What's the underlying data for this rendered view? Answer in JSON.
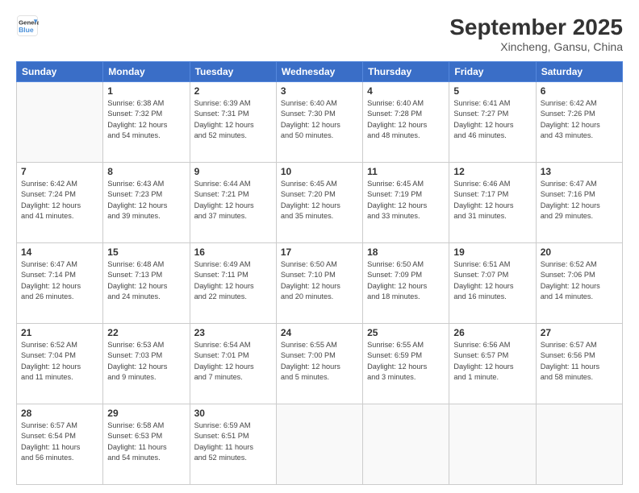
{
  "header": {
    "logo_line1": "General",
    "logo_line2": "Blue",
    "title": "September 2025",
    "subtitle": "Xincheng, Gansu, China"
  },
  "weekdays": [
    "Sunday",
    "Monday",
    "Tuesday",
    "Wednesday",
    "Thursday",
    "Friday",
    "Saturday"
  ],
  "weeks": [
    [
      {
        "day": "",
        "info": ""
      },
      {
        "day": "1",
        "info": "Sunrise: 6:38 AM\nSunset: 7:32 PM\nDaylight: 12 hours\nand 54 minutes."
      },
      {
        "day": "2",
        "info": "Sunrise: 6:39 AM\nSunset: 7:31 PM\nDaylight: 12 hours\nand 52 minutes."
      },
      {
        "day": "3",
        "info": "Sunrise: 6:40 AM\nSunset: 7:30 PM\nDaylight: 12 hours\nand 50 minutes."
      },
      {
        "day": "4",
        "info": "Sunrise: 6:40 AM\nSunset: 7:28 PM\nDaylight: 12 hours\nand 48 minutes."
      },
      {
        "day": "5",
        "info": "Sunrise: 6:41 AM\nSunset: 7:27 PM\nDaylight: 12 hours\nand 46 minutes."
      },
      {
        "day": "6",
        "info": "Sunrise: 6:42 AM\nSunset: 7:26 PM\nDaylight: 12 hours\nand 43 minutes."
      }
    ],
    [
      {
        "day": "7",
        "info": "Sunrise: 6:42 AM\nSunset: 7:24 PM\nDaylight: 12 hours\nand 41 minutes."
      },
      {
        "day": "8",
        "info": "Sunrise: 6:43 AM\nSunset: 7:23 PM\nDaylight: 12 hours\nand 39 minutes."
      },
      {
        "day": "9",
        "info": "Sunrise: 6:44 AM\nSunset: 7:21 PM\nDaylight: 12 hours\nand 37 minutes."
      },
      {
        "day": "10",
        "info": "Sunrise: 6:45 AM\nSunset: 7:20 PM\nDaylight: 12 hours\nand 35 minutes."
      },
      {
        "day": "11",
        "info": "Sunrise: 6:45 AM\nSunset: 7:19 PM\nDaylight: 12 hours\nand 33 minutes."
      },
      {
        "day": "12",
        "info": "Sunrise: 6:46 AM\nSunset: 7:17 PM\nDaylight: 12 hours\nand 31 minutes."
      },
      {
        "day": "13",
        "info": "Sunrise: 6:47 AM\nSunset: 7:16 PM\nDaylight: 12 hours\nand 29 minutes."
      }
    ],
    [
      {
        "day": "14",
        "info": "Sunrise: 6:47 AM\nSunset: 7:14 PM\nDaylight: 12 hours\nand 26 minutes."
      },
      {
        "day": "15",
        "info": "Sunrise: 6:48 AM\nSunset: 7:13 PM\nDaylight: 12 hours\nand 24 minutes."
      },
      {
        "day": "16",
        "info": "Sunrise: 6:49 AM\nSunset: 7:11 PM\nDaylight: 12 hours\nand 22 minutes."
      },
      {
        "day": "17",
        "info": "Sunrise: 6:50 AM\nSunset: 7:10 PM\nDaylight: 12 hours\nand 20 minutes."
      },
      {
        "day": "18",
        "info": "Sunrise: 6:50 AM\nSunset: 7:09 PM\nDaylight: 12 hours\nand 18 minutes."
      },
      {
        "day": "19",
        "info": "Sunrise: 6:51 AM\nSunset: 7:07 PM\nDaylight: 12 hours\nand 16 minutes."
      },
      {
        "day": "20",
        "info": "Sunrise: 6:52 AM\nSunset: 7:06 PM\nDaylight: 12 hours\nand 14 minutes."
      }
    ],
    [
      {
        "day": "21",
        "info": "Sunrise: 6:52 AM\nSunset: 7:04 PM\nDaylight: 12 hours\nand 11 minutes."
      },
      {
        "day": "22",
        "info": "Sunrise: 6:53 AM\nSunset: 7:03 PM\nDaylight: 12 hours\nand 9 minutes."
      },
      {
        "day": "23",
        "info": "Sunrise: 6:54 AM\nSunset: 7:01 PM\nDaylight: 12 hours\nand 7 minutes."
      },
      {
        "day": "24",
        "info": "Sunrise: 6:55 AM\nSunset: 7:00 PM\nDaylight: 12 hours\nand 5 minutes."
      },
      {
        "day": "25",
        "info": "Sunrise: 6:55 AM\nSunset: 6:59 PM\nDaylight: 12 hours\nand 3 minutes."
      },
      {
        "day": "26",
        "info": "Sunrise: 6:56 AM\nSunset: 6:57 PM\nDaylight: 12 hours\nand 1 minute."
      },
      {
        "day": "27",
        "info": "Sunrise: 6:57 AM\nSunset: 6:56 PM\nDaylight: 11 hours\nand 58 minutes."
      }
    ],
    [
      {
        "day": "28",
        "info": "Sunrise: 6:57 AM\nSunset: 6:54 PM\nDaylight: 11 hours\nand 56 minutes."
      },
      {
        "day": "29",
        "info": "Sunrise: 6:58 AM\nSunset: 6:53 PM\nDaylight: 11 hours\nand 54 minutes."
      },
      {
        "day": "30",
        "info": "Sunrise: 6:59 AM\nSunset: 6:51 PM\nDaylight: 11 hours\nand 52 minutes."
      },
      {
        "day": "",
        "info": ""
      },
      {
        "day": "",
        "info": ""
      },
      {
        "day": "",
        "info": ""
      },
      {
        "day": "",
        "info": ""
      }
    ]
  ]
}
